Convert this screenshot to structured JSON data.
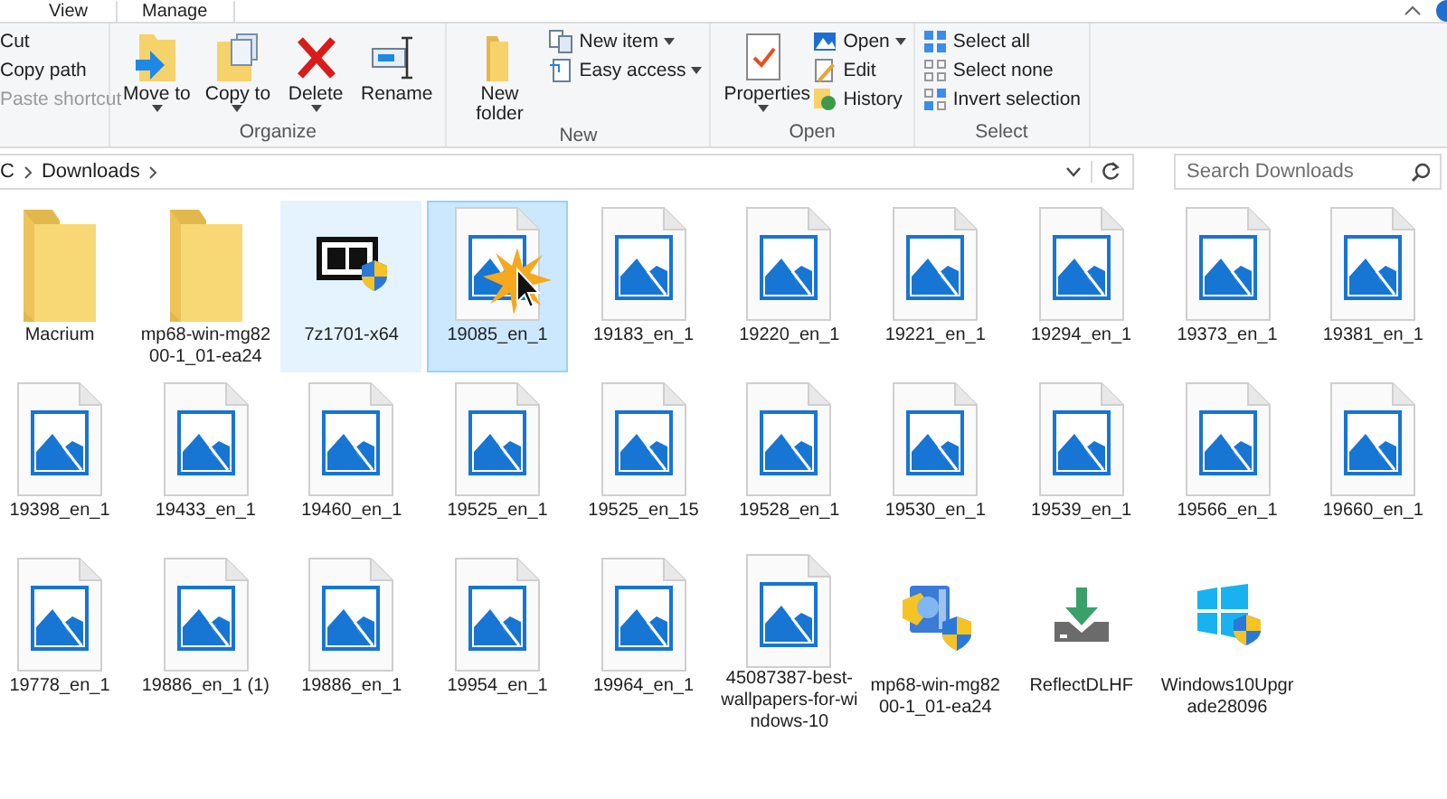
{
  "tabs": [
    {
      "label": "View",
      "selected": false
    },
    {
      "label": "Manage",
      "selected": false
    }
  ],
  "ribbon": {
    "groups": [
      {
        "items": [
          {
            "kind": "small",
            "label": "Cut",
            "disabled": false
          },
          {
            "kind": "small",
            "label": "Copy path",
            "disabled": false
          },
          {
            "kind": "small",
            "label": "Paste shortcut",
            "disabled": true
          }
        ]
      },
      {
        "label": "Organize",
        "items": [
          {
            "kind": "big",
            "label": "Move to",
            "menu": true
          },
          {
            "kind": "big",
            "label": "Copy to",
            "menu": true
          },
          {
            "kind": "big",
            "label": "Delete",
            "menu": true
          },
          {
            "kind": "big",
            "label": "Rename",
            "menu": false
          }
        ]
      },
      {
        "label": "New",
        "items": [
          {
            "kind": "big",
            "label": "New folder",
            "menu": false
          },
          {
            "kind": "small",
            "label": "New item",
            "menu": true
          },
          {
            "kind": "small",
            "label": "Easy access",
            "menu": true
          }
        ]
      },
      {
        "label": "Open",
        "items": [
          {
            "kind": "big",
            "label": "Properties",
            "menu": true
          },
          {
            "kind": "small",
            "label": "Open",
            "menu": true
          },
          {
            "kind": "small",
            "label": "Edit",
            "menu": false
          },
          {
            "kind": "small",
            "label": "History",
            "menu": false
          }
        ]
      },
      {
        "label": "Select",
        "items": [
          {
            "kind": "small",
            "label": "Select all",
            "menu": false
          },
          {
            "kind": "small",
            "label": "Select none",
            "menu": false
          },
          {
            "kind": "small",
            "label": "Invert selection",
            "menu": false
          }
        ]
      }
    ]
  },
  "address": {
    "crumbs": [
      "C",
      "Downloads"
    ]
  },
  "search": {
    "placeholder": "Search Downloads"
  },
  "files": [
    {
      "name": "Macrium",
      "kind": "folder",
      "selected": false,
      "hovered": false
    },
    {
      "name": "mp68-win-mg8200-1_01-ea24",
      "kind": "folder",
      "selected": false,
      "hovered": false
    },
    {
      "name": "7z1701-x64",
      "kind": "archiver",
      "selected": false,
      "hovered": true
    },
    {
      "name": "19085_en_1",
      "kind": "image",
      "selected": true,
      "hovered": false
    },
    {
      "name": "19183_en_1",
      "kind": "image",
      "selected": false,
      "hovered": false
    },
    {
      "name": "19220_en_1",
      "kind": "image",
      "selected": false,
      "hovered": false
    },
    {
      "name": "19221_en_1",
      "kind": "image",
      "selected": false,
      "hovered": false
    },
    {
      "name": "19294_en_1",
      "kind": "image",
      "selected": false,
      "hovered": false
    },
    {
      "name": "19373_en_1",
      "kind": "image",
      "selected": false,
      "hovered": false
    },
    {
      "name": "19381_en_1",
      "kind": "image",
      "selected": false,
      "hovered": false
    },
    {
      "name": "19398_en_1",
      "kind": "image",
      "selected": false,
      "hovered": false
    },
    {
      "name": "19433_en_1",
      "kind": "image",
      "selected": false,
      "hovered": false
    },
    {
      "name": "19460_en_1",
      "kind": "image",
      "selected": false,
      "hovered": false
    },
    {
      "name": "19525_en_1",
      "kind": "image",
      "selected": false,
      "hovered": false
    },
    {
      "name": "19525_en_15",
      "kind": "image",
      "selected": false,
      "hovered": false
    },
    {
      "name": "19528_en_1",
      "kind": "image",
      "selected": false,
      "hovered": false
    },
    {
      "name": "19530_en_1",
      "kind": "image",
      "selected": false,
      "hovered": false
    },
    {
      "name": "19539_en_1",
      "kind": "image",
      "selected": false,
      "hovered": false
    },
    {
      "name": "19566_en_1",
      "kind": "image",
      "selected": false,
      "hovered": false
    },
    {
      "name": "19660_en_1",
      "kind": "image",
      "selected": false,
      "hovered": false
    },
    {
      "name": "19778_en_1",
      "kind": "image",
      "selected": false,
      "hovered": false
    },
    {
      "name": "19886_en_1 (1)",
      "kind": "image",
      "selected": false,
      "hovered": false
    },
    {
      "name": "19886_en_1",
      "kind": "image",
      "selected": false,
      "hovered": false
    },
    {
      "name": "19954_en_1",
      "kind": "image",
      "selected": false,
      "hovered": false
    },
    {
      "name": "19964_en_1",
      "kind": "image",
      "selected": false,
      "hovered": false
    },
    {
      "name": "45087387-best-wallpapers-for-windows-10",
      "kind": "image",
      "selected": false,
      "hovered": false
    },
    {
      "name": "mp68-win-mg8200-1_01-ea24",
      "kind": "installer",
      "selected": false,
      "hovered": false
    },
    {
      "name": "ReflectDLHF",
      "kind": "download",
      "selected": false,
      "hovered": false
    },
    {
      "name": "Windows10Upgrade28096",
      "kind": "setup",
      "selected": false,
      "hovered": false
    }
  ]
}
